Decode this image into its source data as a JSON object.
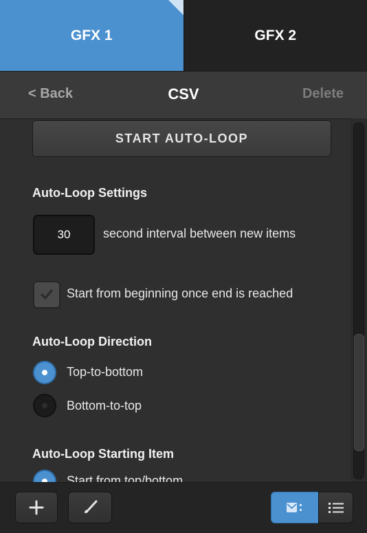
{
  "tabs": [
    {
      "label": "GFX 1",
      "active": true
    },
    {
      "label": "GFX 2",
      "active": false
    }
  ],
  "nav": {
    "back_label": "< Back",
    "title": "CSV",
    "delete_label": "Delete"
  },
  "content": {
    "start_button_label": "START AUTO-LOOP",
    "settings_heading": "Auto-Loop Settings",
    "interval_value": "30",
    "interval_text": "second interval between new items",
    "restart_checkbox_label": "Start from beginning once end is reached",
    "restart_checked": true,
    "direction_heading": "Auto-Loop Direction",
    "direction_options": [
      "Top-to-bottom",
      "Bottom-to-top"
    ],
    "direction_selected": "Top-to-bottom",
    "starting_item_heading": "Auto-Loop Starting Item",
    "starting_item_option_partial": "Start from top/bottom"
  },
  "icons": {
    "add": "plus-icon",
    "brush": "brush-icon",
    "grid_view": "image-grid-icon",
    "list_view": "list-icon"
  },
  "colors": {
    "accent": "#4b90cf",
    "panel_bg": "#2f2f2f",
    "tab_inactive": "#222222"
  }
}
